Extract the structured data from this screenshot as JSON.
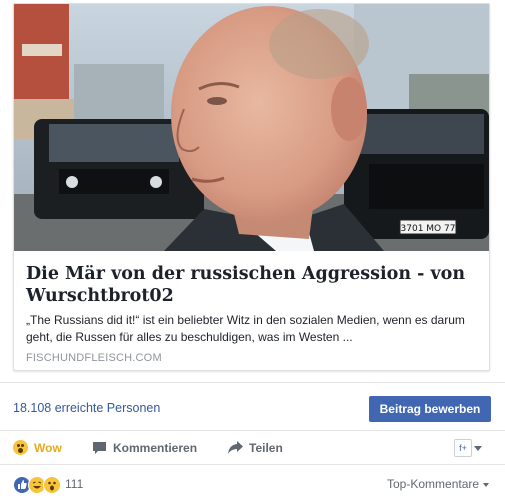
{
  "link_preview": {
    "title": "Die Mär von der russischen Aggression - von Wurschtbrot02",
    "description": "„The Russians did it!“ ist ein beliebter Witz in den sozialen Medien, wenn es darum geht, die Russen für alles zu beschuldigen, was im Westen ...",
    "domain": "FISCHUNDFLEISCH.COM",
    "plate_text": "3701 MO 77"
  },
  "reach": {
    "text": "18.108 erreichte Personen",
    "boost_label": "Beitrag bewerben"
  },
  "actions": {
    "wow_label": "Wow",
    "comment_label": "Kommentieren",
    "share_label": "Teilen"
  },
  "reactions": {
    "count": "111",
    "sort_label": "Top-Kommentare"
  },
  "colors": {
    "link": "#365899",
    "button": "#4267b2",
    "wow": "#e8a91d"
  }
}
